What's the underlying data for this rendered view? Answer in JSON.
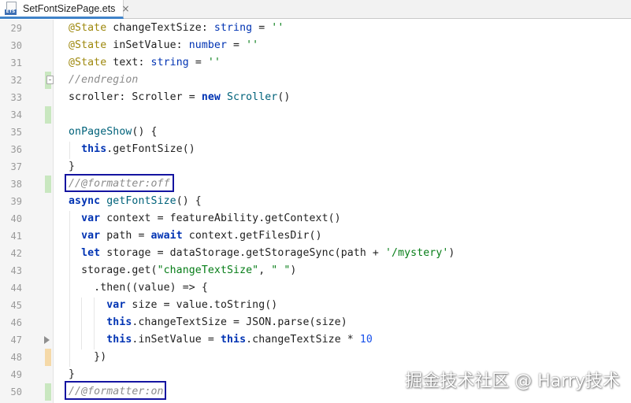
{
  "tab": {
    "icon_text": "ETS",
    "title": "SetFontSizePage.ets",
    "close_glyph": "×"
  },
  "lines": [
    {
      "n": "29",
      "mark": "none",
      "tokens": [
        [
          "deco",
          "  @State "
        ],
        [
          "txt",
          "changeTextSize: "
        ],
        [
          "kwn",
          "string"
        ],
        [
          "txt",
          " = "
        ],
        [
          "str",
          "''"
        ]
      ]
    },
    {
      "n": "30",
      "mark": "none",
      "tokens": [
        [
          "deco",
          "  @State "
        ],
        [
          "txt",
          "inSetValue: "
        ],
        [
          "kwn",
          "number"
        ],
        [
          "txt",
          " = "
        ],
        [
          "str",
          "''"
        ]
      ]
    },
    {
      "n": "31",
      "mark": "none",
      "tokens": [
        [
          "deco",
          "  @State "
        ],
        [
          "txt",
          "text: "
        ],
        [
          "kwn",
          "string"
        ],
        [
          "txt",
          " = "
        ],
        [
          "str",
          "''"
        ]
      ]
    },
    {
      "n": "32",
      "mark": "green",
      "fold": true,
      "tokens": [
        [
          "cmt",
          "  //endregion"
        ]
      ]
    },
    {
      "n": "33",
      "mark": "none",
      "tokens": [
        [
          "txt",
          "  scroller: Scroller = "
        ],
        [
          "kw",
          "new "
        ],
        [
          "fn",
          "Scroller"
        ],
        [
          "txt",
          "()"
        ]
      ]
    },
    {
      "n": "34",
      "mark": "green",
      "tokens": []
    },
    {
      "n": "35",
      "mark": "none",
      "tokens": [
        [
          "fn",
          "  onPageShow"
        ],
        [
          "txt",
          "() {"
        ]
      ]
    },
    {
      "n": "36",
      "mark": "none",
      "tokens": [
        [
          "kw",
          "    this"
        ],
        [
          "txt",
          ".getFontSize()"
        ]
      ]
    },
    {
      "n": "37",
      "mark": "none",
      "tokens": [
        [
          "txt",
          "  }"
        ]
      ]
    },
    {
      "n": "38",
      "mark": "green",
      "tokens": [
        [
          "cmt",
          "  //@formatter:off"
        ]
      ]
    },
    {
      "n": "39",
      "mark": "none",
      "tokens": [
        [
          "kw",
          "  async "
        ],
        [
          "fn",
          "getFontSize"
        ],
        [
          "txt",
          "() {"
        ]
      ]
    },
    {
      "n": "40",
      "mark": "none",
      "tokens": [
        [
          "kw",
          "    var "
        ],
        [
          "txt",
          "context = featureAbility.getContext()"
        ]
      ]
    },
    {
      "n": "41",
      "mark": "none",
      "tokens": [
        [
          "kw",
          "    var "
        ],
        [
          "txt",
          "path = "
        ],
        [
          "kw",
          "await "
        ],
        [
          "txt",
          "context.getFilesDir()"
        ]
      ]
    },
    {
      "n": "42",
      "mark": "none",
      "tokens": [
        [
          "kw",
          "    let "
        ],
        [
          "txt",
          "storage = dataStorage.getStorageSync(path + "
        ],
        [
          "str",
          "'/mystery'"
        ],
        [
          "txt",
          ")"
        ]
      ]
    },
    {
      "n": "43",
      "mark": "none",
      "tokens": [
        [
          "txt",
          "    storage.get("
        ],
        [
          "str",
          "\"changeTextSize\""
        ],
        [
          "txt",
          ", "
        ],
        [
          "str",
          "\" \""
        ],
        [
          "txt",
          ")"
        ]
      ]
    },
    {
      "n": "44",
      "mark": "none",
      "tokens": [
        [
          "txt",
          "      .then((value) => {"
        ]
      ]
    },
    {
      "n": "45",
      "mark": "none",
      "tokens": [
        [
          "kw",
          "        var "
        ],
        [
          "txt",
          "size = value.toString()"
        ]
      ]
    },
    {
      "n": "46",
      "mark": "none",
      "tokens": [
        [
          "kw",
          "        this"
        ],
        [
          "txt",
          ".changeTextSize = JSON.parse(size)"
        ]
      ]
    },
    {
      "n": "47",
      "mark": "none",
      "arrow": true,
      "tokens": [
        [
          "kw",
          "        this"
        ],
        [
          "txt",
          ".inSetValue = "
        ],
        [
          "kw",
          "this"
        ],
        [
          "txt",
          ".changeTextSize * "
        ],
        [
          "num",
          "10"
        ]
      ]
    },
    {
      "n": "48",
      "mark": "yellow",
      "tokens": [
        [
          "txt",
          "      })"
        ]
      ]
    },
    {
      "n": "49",
      "mark": "none",
      "tokens": [
        [
          "txt",
          "  }"
        ]
      ]
    },
    {
      "n": "50",
      "mark": "green",
      "tokens": [
        [
          "cmt",
          "  //@formatter:on"
        ]
      ]
    }
  ],
  "watermark": "掘金技术社区 @ Harry技术"
}
